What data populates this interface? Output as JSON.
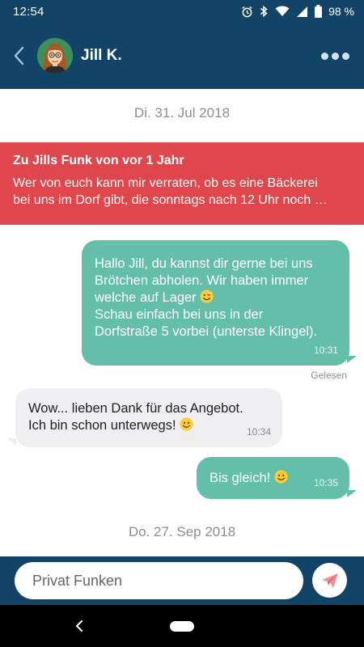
{
  "status_bar": {
    "time": "12:54",
    "battery": "98 %",
    "icons": [
      "alarm-icon",
      "bluetooth-icon",
      "wifi-icon",
      "signal-icon",
      "battery-icon"
    ]
  },
  "header": {
    "contact_name": "Jill K.",
    "back_icon": "chevron-left-icon",
    "menu_icon": "more-dots-icon"
  },
  "chat": {
    "date_1": "Di. 31. Jul 2018",
    "banner": {
      "title": "Zu Jills Funk von vor 1 Jahr",
      "text_line_1": "Wer von euch kann mir verraten, ob es eine Bäckerei",
      "text_line_2": "bei uns im Dorf gibt, die sonntags nach 12 Uhr noch …"
    },
    "messages": [
      {
        "direction": "outgoing",
        "lines": [
          "Hallo Jill, du kannst dir gerne bei uns",
          "Brötchen abholen. Wir haben immer",
          "welche auf Lager",
          "Schau einfach bei uns in der",
          "Dorfstraße 5 vorbei (unterste Klingel)."
        ],
        "emoji": "wink-emoji",
        "time": "10:31",
        "status": "Gelesen"
      },
      {
        "direction": "incoming",
        "lines": [
          "Wow... lieben Dank für das Angebot.",
          "Ich bin schon unterwegs!"
        ],
        "emoji": "smile-emoji",
        "time": "10:34"
      },
      {
        "direction": "outgoing",
        "lines": [
          "Bis gleich!"
        ],
        "emoji": "smile-emoji",
        "time": "10:35"
      }
    ],
    "date_2": "Do. 27. Sep 2018"
  },
  "composer": {
    "placeholder": "Privat Funken",
    "send_icon": "paper-plane-icon"
  },
  "colors": {
    "primary": "#124468",
    "banner": "#e0474c",
    "outgoing_bubble": "#63bfaa",
    "incoming_bubble": "#efeff1"
  }
}
